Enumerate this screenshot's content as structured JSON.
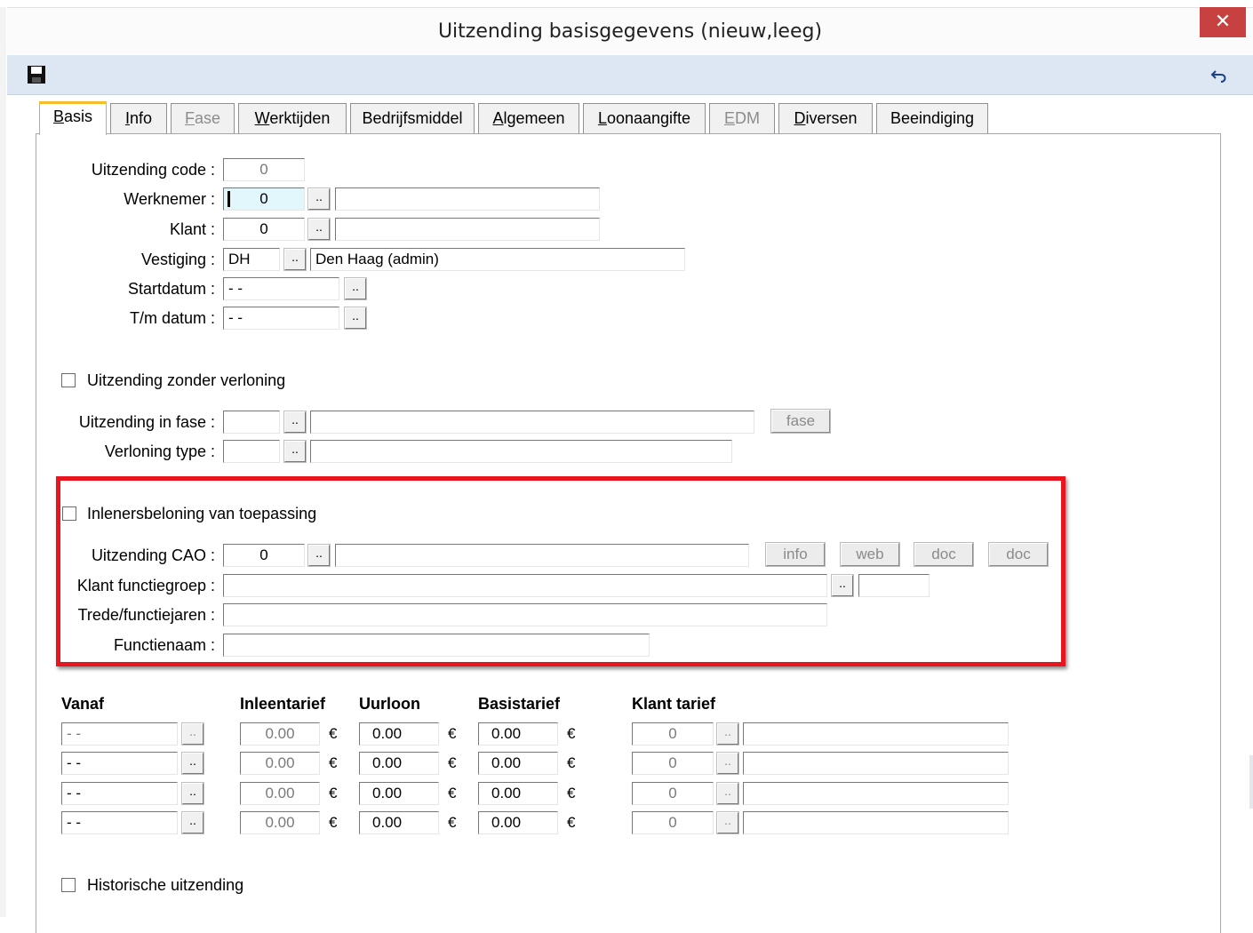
{
  "window": {
    "title": "Uitzending basisgegevens  (nieuw,leeg)",
    "close_label": "✕"
  },
  "toolbar": {
    "save_icon": "floppy-disk-icon",
    "undo_icon": "undo-arrow-icon"
  },
  "tabs": [
    {
      "label": "Basis",
      "underline": "B",
      "rest": "asis",
      "active": true,
      "enabled": true
    },
    {
      "label": "Info",
      "underline": "I",
      "rest": "nfo",
      "active": false,
      "enabled": true
    },
    {
      "label": "Fase",
      "underline": "F",
      "rest": "ase",
      "active": false,
      "enabled": false
    },
    {
      "label": "Werktijden",
      "underline": "W",
      "rest": "erktijden",
      "active": false,
      "enabled": true
    },
    {
      "label": "Bedrijfsmiddel",
      "active": false,
      "enabled": true
    },
    {
      "label": "Algemeen",
      "underline": "A",
      "rest": "lgemeen",
      "active": false,
      "enabled": true
    },
    {
      "label": "Loonaangifte",
      "underline": "L",
      "rest": "oonaangifte",
      "active": false,
      "enabled": true
    },
    {
      "label": "EDM",
      "underline": "E",
      "rest": "DM",
      "active": false,
      "enabled": false
    },
    {
      "label": "Diversen",
      "underline": "D",
      "rest": "iversen",
      "active": false,
      "enabled": true
    },
    {
      "label": "Beeindiging",
      "active": false,
      "enabled": true
    }
  ],
  "form": {
    "uitzending_code": {
      "label": "Uitzending code :",
      "value": "0"
    },
    "werknemer": {
      "label": "Werknemer :",
      "value": "0",
      "name": ""
    },
    "klant": {
      "label": "Klant :",
      "value": "0",
      "name": ""
    },
    "vestiging": {
      "label": "Vestiging :",
      "value": "DH",
      "name": "Den Haag (admin)"
    },
    "startdatum": {
      "label": "Startdatum :",
      "value": " - -"
    },
    "tm_datum": {
      "label": "T/m datum :",
      "value": " - -"
    },
    "browse_label": "..",
    "zonder_verloning": {
      "label": "Uitzending zonder verloning",
      "checked": false
    },
    "in_fase": {
      "label": "Uitzending in fase :",
      "value": "",
      "name": "",
      "button": "fase"
    },
    "verloning_type": {
      "label": "Verloning type :",
      "value": "",
      "name": ""
    },
    "inlenersbeloning": {
      "label": "Inlenersbeloning van toepassing",
      "checked": false
    },
    "cao": {
      "label": "Uitzending CAO :",
      "value": "0",
      "name": "",
      "buttons": [
        "info",
        "web",
        "doc",
        "doc"
      ]
    },
    "functiegroep": {
      "label": "Klant functiegroep :",
      "value": "",
      "extra": ""
    },
    "trede": {
      "label": "Trede/functiejaren :",
      "value": ""
    },
    "functienaam": {
      "label": "Functienaam :",
      "value": ""
    },
    "historisch": {
      "label": "Historische uitzending",
      "checked": false
    }
  },
  "tarieven": {
    "headers": {
      "vanaf": "Vanaf",
      "inleentarief": "Inleentarief",
      "uurloon": "Uurloon",
      "basistarief": "Basistarief",
      "klant_tarief": "Klant tarief"
    },
    "currency": "€",
    "rows": [
      {
        "vanaf": " - -",
        "inleentarief": "0.00",
        "uurloon": "0.00",
        "basistarief": "0.00",
        "klant_tarief": "0",
        "klant_naam": ""
      },
      {
        "vanaf": " - -",
        "inleentarief": "0.00",
        "uurloon": "0.00",
        "basistarief": "0.00",
        "klant_tarief": "0",
        "klant_naam": ""
      },
      {
        "vanaf": " - -",
        "inleentarief": "0.00",
        "uurloon": "0.00",
        "basistarief": "0.00",
        "klant_tarief": "0",
        "klant_naam": ""
      },
      {
        "vanaf": " - -",
        "inleentarief": "0.00",
        "uurloon": "0.00",
        "basistarief": "0.00",
        "klant_tarief": "0",
        "klant_naam": ""
      }
    ]
  },
  "colors": {
    "highlight_border": "#e8141e",
    "active_tab_accent": "#f6bd2d",
    "close_button": "#c84141",
    "toolbar_bg": "#dde6f3"
  }
}
